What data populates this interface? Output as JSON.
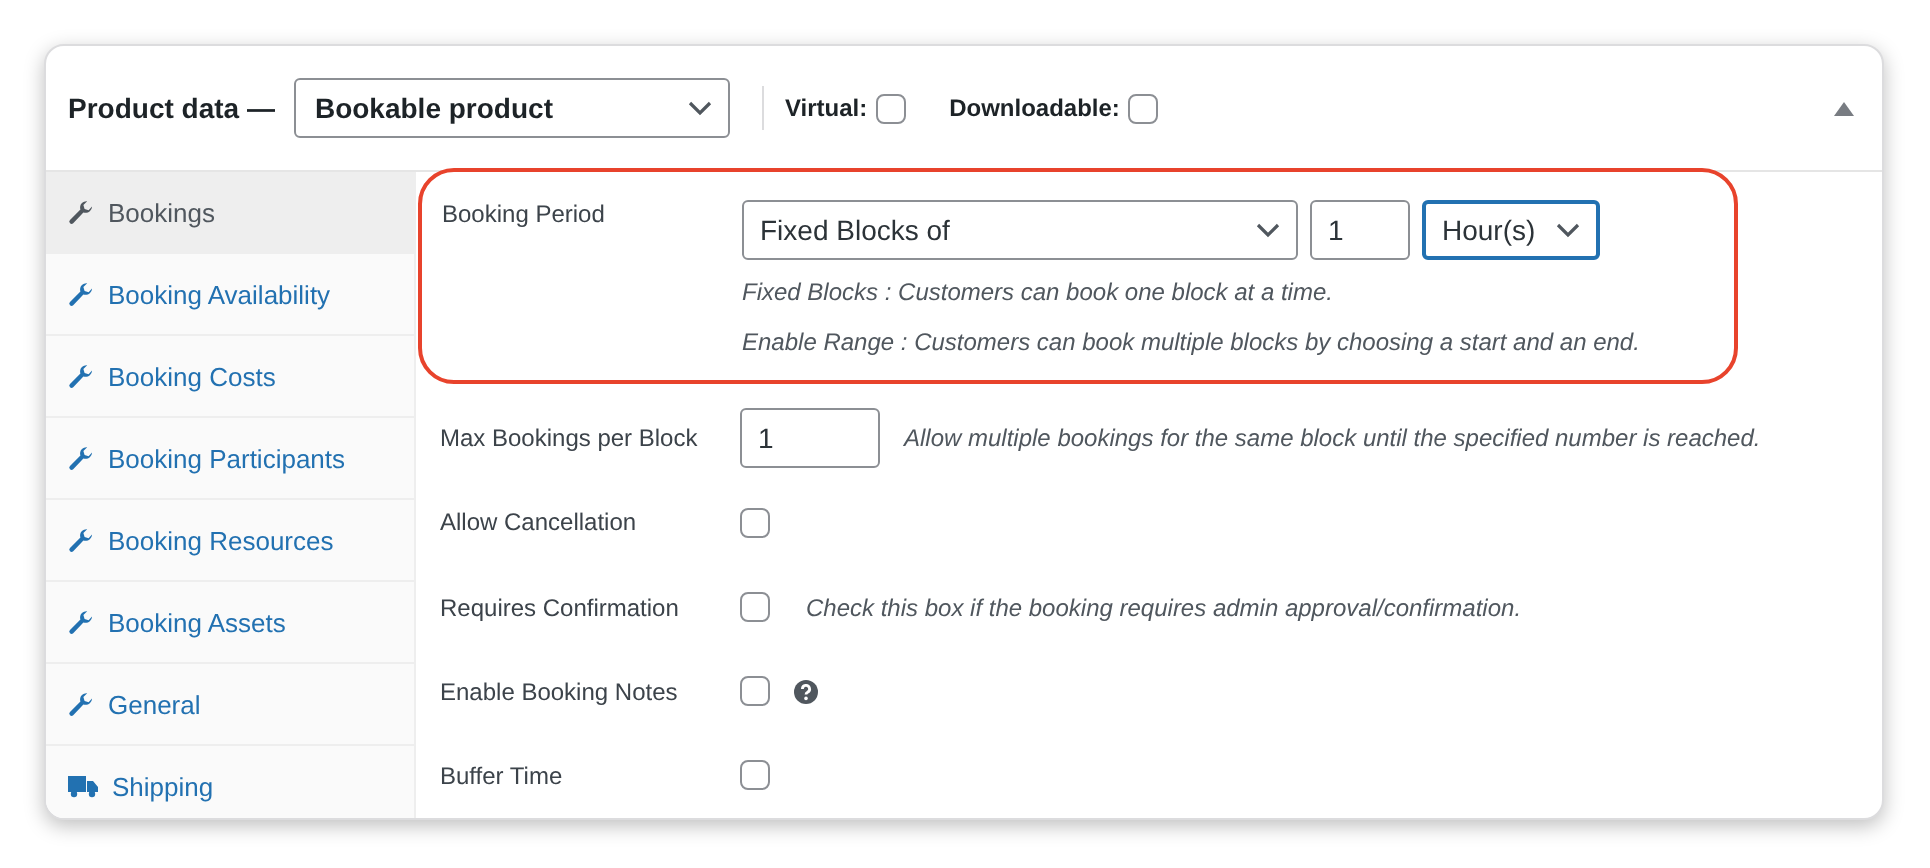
{
  "header": {
    "title": "Product data —",
    "product_type": "Bookable product",
    "options": [
      {
        "label": "Virtual:",
        "checked": false
      },
      {
        "label": "Downloadable:",
        "checked": false
      }
    ]
  },
  "tabs": [
    {
      "label": "Bookings",
      "kind": "wrench",
      "selected": true
    },
    {
      "label": "Booking Availability",
      "kind": "wrench",
      "selected": false
    },
    {
      "label": "Booking Costs",
      "kind": "wrench",
      "selected": false
    },
    {
      "label": "Booking Participants",
      "kind": "wrench",
      "selected": false
    },
    {
      "label": "Booking Resources",
      "kind": "wrench",
      "selected": false
    },
    {
      "label": "Booking Assets",
      "kind": "wrench",
      "selected": false
    },
    {
      "label": "General",
      "kind": "wrench",
      "selected": false
    },
    {
      "label": "Shipping",
      "kind": "truck",
      "selected": false
    }
  ],
  "fields": [
    {
      "kind": "period",
      "label": "Booking Period",
      "highlighted": true,
      "mode": "Fixed Blocks of",
      "amount": "1",
      "unit": "Hour(s)",
      "unit_focused": true,
      "notes": [
        "Fixed Blocks : Customers can book one block at a time.",
        "Enable Range : Customers can book multiple blocks by choosing a start and an end."
      ]
    },
    {
      "kind": "number",
      "label": "Max Bookings per Block",
      "value": "1",
      "description": "Allow multiple bookings for the same block until the specified number is reached."
    },
    {
      "kind": "checkbox",
      "label": "Allow Cancellation",
      "checked": false
    },
    {
      "kind": "checkbox",
      "label": "Requires Confirmation",
      "checked": false,
      "description": "Check this box if the booking requires admin approval/confirmation."
    },
    {
      "kind": "checkbox",
      "label": "Enable Booking Notes",
      "checked": false,
      "help": true
    },
    {
      "kind": "checkbox",
      "label": "Buffer Time",
      "checked": false
    }
  ]
}
